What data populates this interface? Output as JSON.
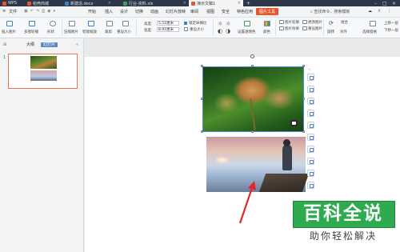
{
  "titlebar": {
    "tabs": [
      {
        "label": "WPS",
        "color": "#e8572a",
        "active": false
      },
      {
        "label": "稻壳商城",
        "color": "#e8572a",
        "active": false
      },
      {
        "label": "新建造.docx",
        "color": "#3b82c4",
        "active": false
      },
      {
        "label": "行业-资料.xls",
        "color": "#3aa35b",
        "active": false
      },
      {
        "label": "演示文稿1",
        "color": "#e8572a",
        "active": true
      }
    ]
  },
  "menubar": {
    "file": "文件",
    "items": [
      "开始",
      "插入",
      "设计",
      "切换",
      "动画",
      "幻灯片放映",
      "审阅",
      "视图",
      "安全",
      "特色应用"
    ],
    "active": "图片工具",
    "search": "查找命令、搜索模板"
  },
  "ribbon": {
    "insert_image": "插入图片",
    "multi_image": "多图轮播",
    "shape": "形状",
    "compress": "压缩图片",
    "smart_zoom": "智能缩放",
    "crop": "裁剪",
    "reset_size": "重设大小",
    "height_label": "高度:",
    "height_value": "5.51厘米",
    "width_label": "宽度:",
    "width_value": "8.91厘米",
    "lock_ratio": "锁定纵横比",
    "reset_size2": "重设大小",
    "transparent": "设置透明色",
    "color": "颜色",
    "image_outline": "图片轮廓",
    "image_effect": "图片效果",
    "change_image": "更改图片",
    "reset_image": "重设图片",
    "combine": "组合",
    "rotate": "旋转",
    "align": "对齐",
    "select_pane": "选择窗格",
    "bring_forward": "上移一层",
    "send_backward": "下移一层"
  },
  "leftpanel": {
    "tab_outline": "大纲",
    "tab_slides": "幻灯片",
    "slide_number": "1"
  },
  "watermark": {
    "title": "百科全说",
    "subtitle": "助你轻松解决"
  }
}
